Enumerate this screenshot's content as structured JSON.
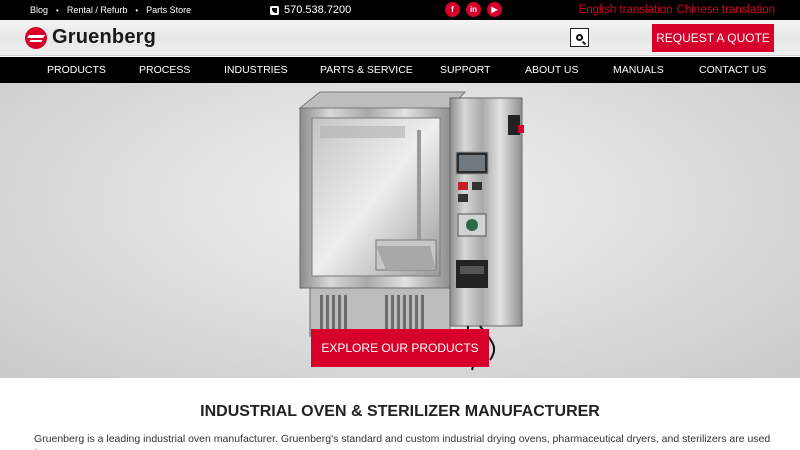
{
  "topbar": {
    "links": [
      "Blog",
      "Rental / Refurb",
      "Parts Store"
    ],
    "separator": "•",
    "phone": "570.538.7200",
    "socials": [
      {
        "name": "facebook",
        "glyph": "f"
      },
      {
        "name": "linkedin",
        "glyph": "in"
      },
      {
        "name": "youtube",
        "glyph": "▶"
      }
    ],
    "translate": [
      "English translation",
      "Chinese translation"
    ]
  },
  "header": {
    "logo_text": "Gruenberg",
    "quote_label": "REQUEST A QUOTE",
    "search_icon": "search-icon"
  },
  "nav": {
    "items": [
      "PRODUCTS",
      "PROCESS",
      "INDUSTRIES",
      "PARTS & SERVICE",
      "SUPPORT",
      "ABOUT US",
      "MANUALS",
      "CONTACT US"
    ]
  },
  "hero": {
    "button_label": "EXPLORE OUR PRODUCTS"
  },
  "content": {
    "title": "INDUSTRIAL OVEN & STERILIZER MANUFACTURER",
    "body": "Gruenberg is a leading industrial oven manufacturer. Gruenberg's standard and custom industrial drying ovens, pharmaceutical dryers, and sterilizers are used for a"
  },
  "colors": {
    "brand_red": "#d6002a",
    "nav_bg": "#000000"
  }
}
